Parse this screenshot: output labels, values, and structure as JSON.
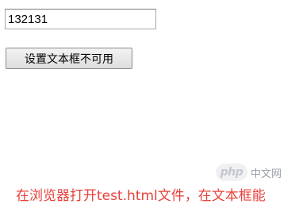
{
  "form": {
    "input_value": "132131",
    "button_label": "设置文本框不可用"
  },
  "watermark": {
    "logo_text": "php",
    "site_text": "中文网"
  },
  "caption": {
    "text": "在浏览器打开test.html文件，在文本框能"
  },
  "colors": {
    "caption": "#e8403a",
    "watermark_text": "#9a9fa8"
  }
}
